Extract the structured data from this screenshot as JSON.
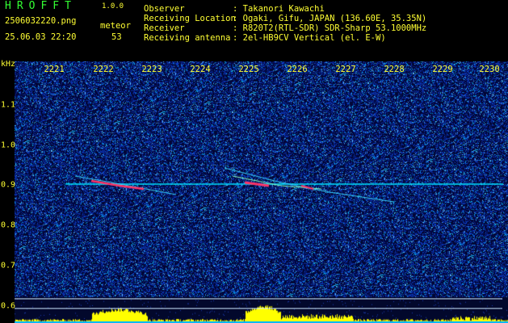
{
  "app": {
    "logo": "HROFFT",
    "version": "1.0.0"
  },
  "file": {
    "name": "2506032220.png",
    "datetime": "25.06.03 22:20",
    "meteor_label": "meteor",
    "meteor_count": "53"
  },
  "station": {
    "observer_label": "Observer",
    "observer_value": ": Takanori Kawachi",
    "location_label": "Receiving Location",
    "location_value": ": Ogaki, Gifu, JAPAN (136.60E, 35.35N)",
    "receiver_label": "Receiver",
    "receiver_value": ": R820T2(RTL-SDR) SDR-Sharp 53.1000MHz",
    "antenna_label": "Receiving antenna",
    "antenna_value": ": 2el-HB9CV Vertical (el. E-W)"
  },
  "axis": {
    "y_unit": "kHz",
    "x_labels": [
      "2221",
      "2222",
      "2223",
      "2224",
      "2225",
      "2226",
      "2227",
      "2228",
      "2229",
      "2230"
    ],
    "y_labels": [
      "1.1",
      "1.0",
      "0.9",
      "0.8",
      "0.7",
      "0.6"
    ]
  },
  "colors": {
    "text": "#ffff33",
    "logo": "#33ff33",
    "carrier": "#00e5ff",
    "echo": "#ff3366",
    "level_bar": "#ffff00"
  }
}
